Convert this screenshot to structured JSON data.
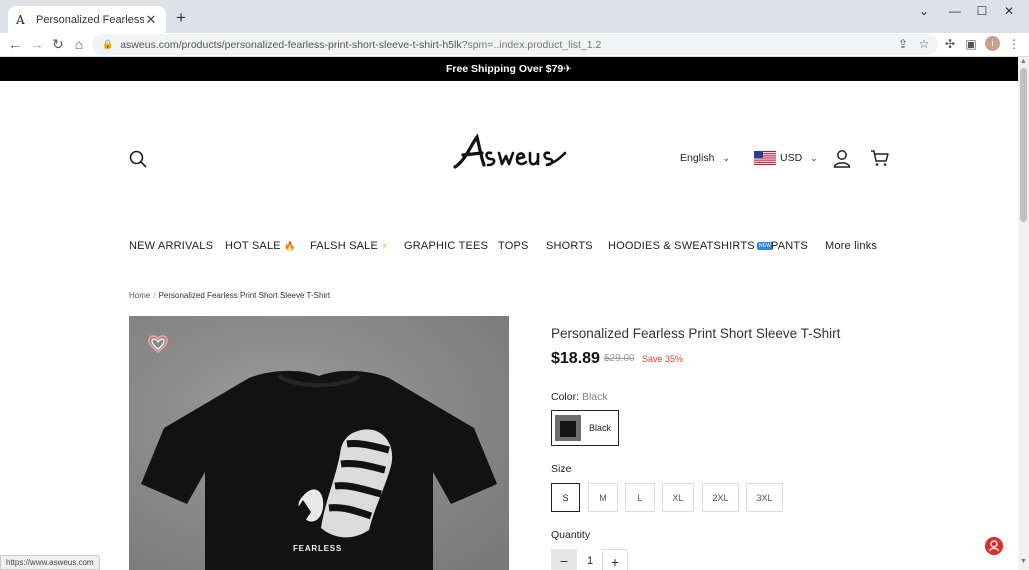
{
  "browser": {
    "tab_title": "Personalized Fearless Print Short",
    "tab_favicon": "A",
    "url_main": "asweus.com/products/personalized-fearless-print-short-sleeve-t-shirt-h5lk",
    "url_query": "?spm=..index.product_list_1.2",
    "status_url": "https://www.asweus.com",
    "profile_initial": "i"
  },
  "announcement": "Free Shipping Over $79✈",
  "header": {
    "logo_text": "Asweus",
    "language": "English",
    "currency": "USD"
  },
  "nav": {
    "items": [
      {
        "label": "NEW ARRIVALS"
      },
      {
        "label": "HOT SALE",
        "emoji": "🔥"
      },
      {
        "label": "FALSH SALE",
        "emoji": "⚡"
      },
      {
        "label": "GRAPHIC TEES"
      },
      {
        "label": "TOPS"
      },
      {
        "label": "SHORTS"
      },
      {
        "label": "HOODIES & SWEATSHIRTS",
        "badge": "NEW"
      },
      {
        "label": "PANTS"
      },
      {
        "label": "More links"
      }
    ]
  },
  "breadcrumb": {
    "home": "Home",
    "separator": "/",
    "current": "Personalized Fearless Print Short Sleeve T-Shirt"
  },
  "product": {
    "title": "Personalized Fearless Print Short Sleeve T-Shirt",
    "price": "$18.89",
    "compare_price": "$29.00",
    "save": "Save 35%",
    "image_text": "FEARLESS",
    "color_label": "Color:",
    "color_value": "Black",
    "color_option": "Black",
    "size_label": "Size",
    "sizes": [
      "S",
      "M",
      "L",
      "XL",
      "2XL",
      "3XL"
    ],
    "selected_size": "S",
    "quantity_label": "Quantity",
    "quantity": "1",
    "minus": "−",
    "plus": "+"
  },
  "colors": {
    "announcement_bg": "#000000",
    "sale_red": "#e0413b",
    "chat_red": "#d92f2f"
  }
}
